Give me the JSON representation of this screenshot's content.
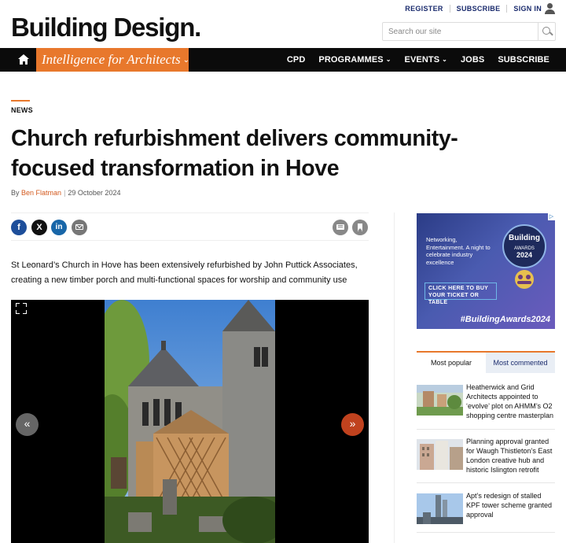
{
  "utility": {
    "register": "REGISTER",
    "subscribe": "SUBSCRIBE",
    "sign_in": "SIGN IN"
  },
  "brand": {
    "logo": "Building Design.",
    "tagline": "Intelligence for Architects",
    "accent_color": "#e8782c"
  },
  "search": {
    "placeholder": "Search our site"
  },
  "nav": {
    "cpd": "CPD",
    "programmes": "PROGRAMMES",
    "events": "EVENTS",
    "jobs": "JOBS",
    "subscribe": "SUBSCRIBE"
  },
  "article": {
    "kicker": "NEWS",
    "headline": "Church refurbishment delivers community-focused transformation in Hove",
    "byline_prefix": "By",
    "author": "Ben Flatman",
    "date": "29 October 2024",
    "standfirst": "St Leonard’s Church in Hove has been extensively refurbished by John Puttick Associates, creating a new timber porch and multi-functional spaces for worship and community use"
  },
  "share": {
    "facebook": "f",
    "x": "X",
    "linkedin": "in"
  },
  "gallery": {
    "prev": "«",
    "next": "»"
  },
  "ad": {
    "text": "Networking, Entertainment. A night to celebrate industry excellence",
    "badge_brand": "Building",
    "badge_awards": "AWARDS",
    "badge_year": "2024",
    "cta": "CLICK HERE TO BUY YOUR TICKET OR TABLE",
    "hashtag": "#BuildingAwards2024"
  },
  "popular": {
    "tab_popular": "Most popular",
    "tab_commented": "Most commented",
    "items": [
      {
        "title": "Heatherwick and Grid Architects appointed to ‘evolve’ plot on AHMM’s O2 shopping centre masterplan"
      },
      {
        "title": "Planning approval granted for Waugh Thistleton’s East London creative hub and historic Islington retrofit"
      },
      {
        "title": "Apt’s redesign of stalled KPF tower scheme granted approval"
      }
    ]
  }
}
